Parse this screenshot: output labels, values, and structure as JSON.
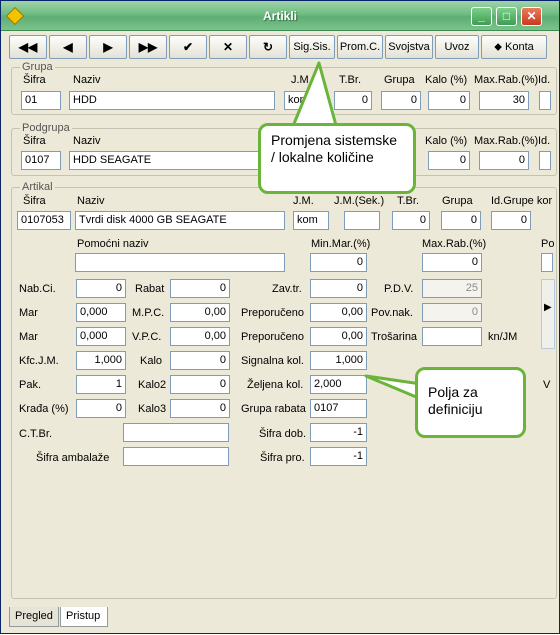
{
  "window": {
    "title": "Artikli"
  },
  "toolbar": {
    "first": "◀◀",
    "prev": "◀",
    "next": "▶",
    "last": "▶▶",
    "accept": "✔",
    "cancel": "✕",
    "refresh": "↻",
    "sig_sis": "Sig.Sis.",
    "prom_c": "Prom.C.",
    "svojstva": "Svojstva",
    "uvoz": "Uvoz",
    "konta": "Konta"
  },
  "grupa": {
    "legend": "Grupa",
    "labels": {
      "sifra": "Šifra",
      "naziv": "Naziv",
      "jm": "J.M.",
      "tbr": "T.Br.",
      "grupa": "Grupa",
      "kalo": "Kalo (%)",
      "maxrab": "Max.Rab.(%)",
      "id": "Id."
    },
    "values": {
      "sifra": "01",
      "naziv": "HDD",
      "jm": "kom",
      "tbr": "0",
      "grupa": "0",
      "kalo": "0",
      "maxrab": "30"
    }
  },
  "podgrupa": {
    "legend": "Podgrupa",
    "labels": {
      "sifra": "Šifra",
      "naziv": "Naziv",
      "kalo": "Kalo (%)",
      "maxrab": "Max.Rab.(%)",
      "id": "Id."
    },
    "values": {
      "sifra": "0107",
      "naziv": "HDD SEAGATE",
      "kalo": "0",
      "maxrab": "0"
    }
  },
  "artikal": {
    "legend": "Artikal",
    "labels": {
      "sifra": "Šifra",
      "naziv": "Naziv",
      "jm": "J.M.",
      "jmsek": "J.M.(Sek.)",
      "tbr": "T.Br.",
      "grupa": "Grupa",
      "idgrupe": "Id.Grupe kor",
      "pomocni": "Pomoćni naziv",
      "minmar": "Min.Mar.(%)",
      "maxrab": "Max.Rab.(%)",
      "po": "Po",
      "nabci": "Nab.Ci.",
      "rabat": "Rabat",
      "zavtr": "Zav.tr.",
      "pdv": "P.D.V.",
      "mar1": "Mar",
      "mpc": "M.P.C.",
      "prep1": "Preporučeno",
      "povnak": "Pov.nak.",
      "mar2": "Mar",
      "vpc": "V.P.C.",
      "prep2": "Preporučeno",
      "trosarina": "Trošarina",
      "knjm": "kn/JM",
      "kfcjm": "Kfc.J.M.",
      "kalo": "Kalo",
      "signalna": "Signalna kol.",
      "pak": "Pak.",
      "kalo2": "Kalo2",
      "zeljena": "Željena kol.",
      "v": "V",
      "krada": "Krađa (%)",
      "kalo3": "Kalo3",
      "grupa_rabata": "Grupa rabata",
      "ctbr": "C.T.Br.",
      "sifra_dob": "Šifra dob.",
      "sifra_amb": "Šifra ambalaže",
      "sifra_pro": "Šifra pro."
    },
    "values": {
      "sifra": "0107053",
      "naziv": "Tvrdi disk 4000 GB SEAGATE",
      "jm": "kom",
      "tbr": "0",
      "grupa": "0",
      "idgrupe": "0",
      "minmar": "0",
      "maxrab": "0",
      "nabci": "0",
      "rabat": "0",
      "zavtr": "0",
      "pdv": "25",
      "mar1": "0,000",
      "mpc": "0,00",
      "prep1": "0,00",
      "povnak": "0",
      "mar2": "0,000",
      "vpc": "0,00",
      "prep2": "0,00",
      "kfcjm": "1,000",
      "kalo": "0",
      "signalna": "1,000",
      "pak": "1",
      "kalo2": "0",
      "zeljena": "2,000",
      "krada": "0",
      "kalo3": "0",
      "grupa_rabata": "0107",
      "sifra_dob": "-1",
      "sifra_pro": "-1"
    }
  },
  "callouts": {
    "sig": "Promjena sistemske / lokalne količine",
    "polja": "Polja za definiciju"
  },
  "tabs": {
    "pregled": "Pregled",
    "pristup": "Pristup"
  },
  "colors": {
    "callout_border": "#6bb43a",
    "titlebar": "#6fbd83"
  }
}
